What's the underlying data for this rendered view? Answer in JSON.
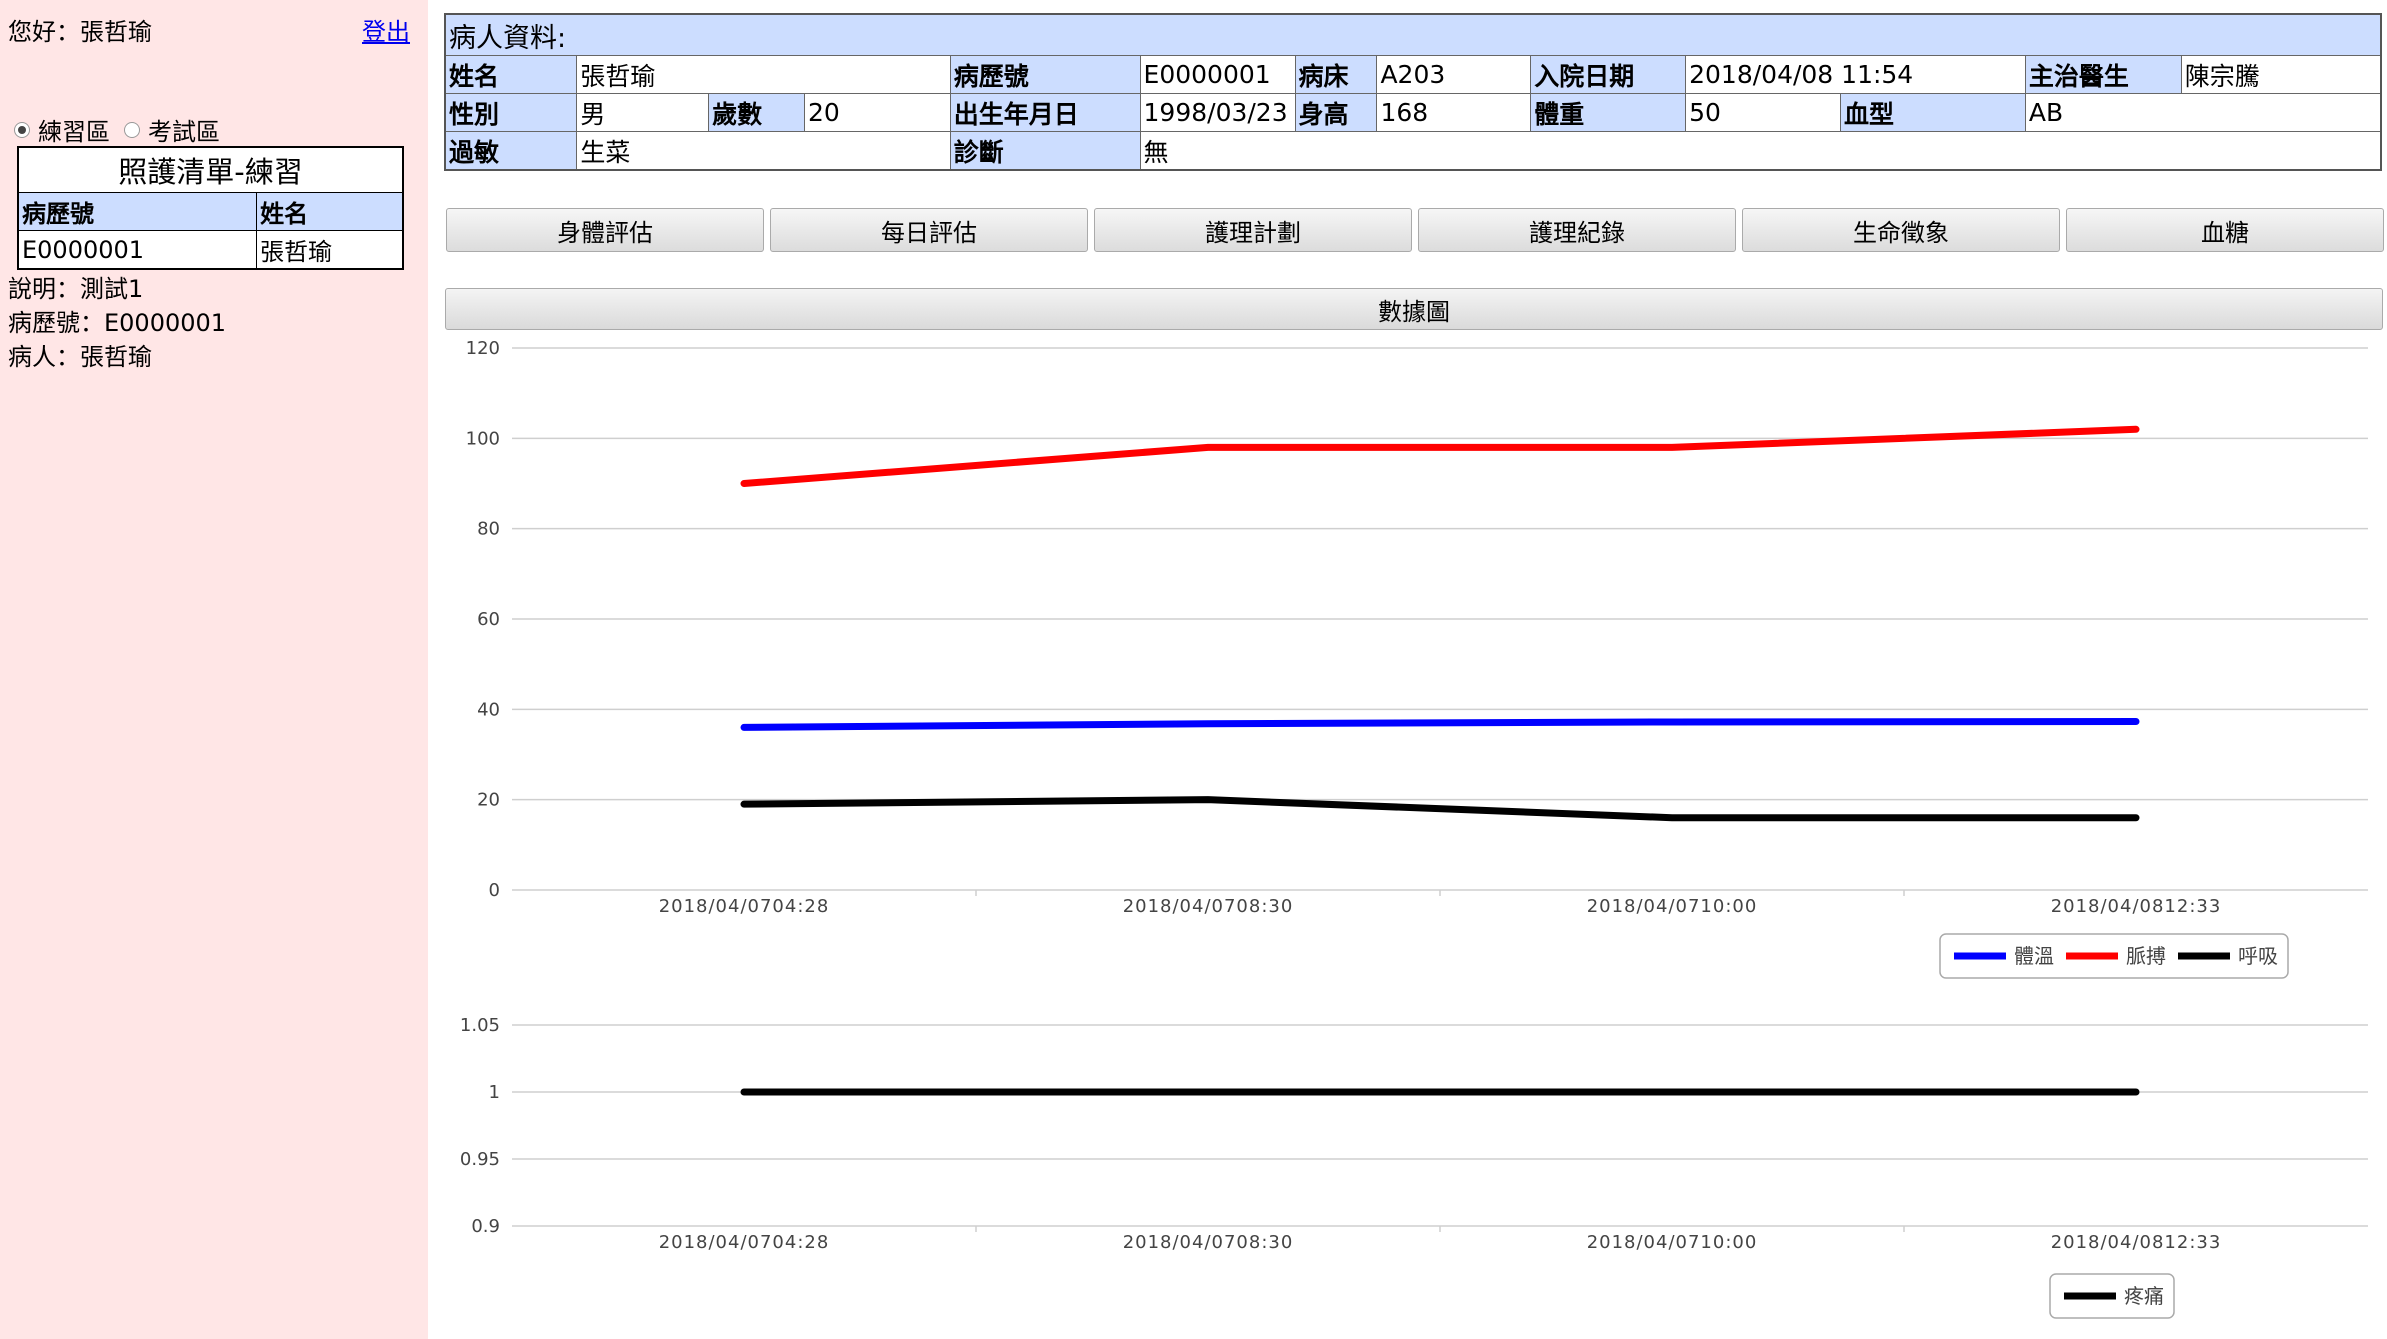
{
  "user": {
    "greeting": "您好：張哲瑜",
    "logout": "登出"
  },
  "modes": [
    {
      "label": "練習區",
      "selected": true
    },
    {
      "label": "考試區",
      "selected": false
    }
  ],
  "care_list": {
    "caption": "照護清單-練習",
    "headers": [
      "病歷號",
      "姓名"
    ],
    "rows": [
      [
        "E0000001",
        "張哲瑜"
      ]
    ]
  },
  "notes": [
    "說明：測試1",
    "病歷號：E0000001",
    "病人：張哲瑜"
  ],
  "patient": {
    "title": "病人資料:",
    "name_label": "姓名",
    "name": "張哲瑜",
    "record_label": "病歷號",
    "record": "E0000001",
    "bed_label": "病床",
    "bed": "A203",
    "admit_label": "入院日期",
    "admit": "2018/04/08 11:54",
    "doctor_label": "主治醫生",
    "doctor": "陳宗騰",
    "sex_label": "性別",
    "sex": "男",
    "age_label": "歲數",
    "age": "20",
    "dob_label": "出生年月日",
    "dob": "1998/03/23",
    "height_label": "身高",
    "height": "168",
    "weight_label": "體重",
    "weight": "50",
    "blood_label": "血型",
    "blood": "AB",
    "allergy_label": "過敏",
    "allergy": "生菜",
    "diagnosis_label": "診斷",
    "diagnosis": "無"
  },
  "tabs": [
    "身體評估",
    "每日評估",
    "護理計劃",
    "護理紀錄",
    "生命徵象",
    "血糖"
  ],
  "chart_button": "數據圖",
  "chart_data": [
    {
      "type": "line",
      "x": [
        "2018/04/0704:28",
        "2018/04/0708:30",
        "2018/04/0710:00",
        "2018/04/0812:33"
      ],
      "ylim": [
        0,
        120
      ],
      "yticks": [
        0,
        20,
        40,
        60,
        80,
        100,
        120
      ],
      "grid": true,
      "legend": "bottom-right",
      "series": [
        {
          "name": "體溫",
          "color": "#0000ff",
          "values": [
            36,
            36.8,
            37.2,
            37.3
          ]
        },
        {
          "name": "脈搏",
          "color": "#ff0000",
          "values": [
            90,
            98,
            98,
            102
          ]
        },
        {
          "name": "呼吸",
          "color": "#000000",
          "values": [
            19,
            20,
            16,
            16
          ]
        }
      ]
    },
    {
      "type": "line",
      "x": [
        "2018/04/0704:28",
        "2018/04/0708:30",
        "2018/04/0710:00",
        "2018/04/0812:33"
      ],
      "ylim": [
        0.9,
        1.05
      ],
      "yticks": [
        0.9,
        0.95,
        1,
        1.05
      ],
      "grid": true,
      "legend": "bottom-right",
      "series": [
        {
          "name": "疼痛",
          "color": "#000000",
          "values": [
            1,
            1,
            1,
            1
          ]
        }
      ]
    }
  ]
}
